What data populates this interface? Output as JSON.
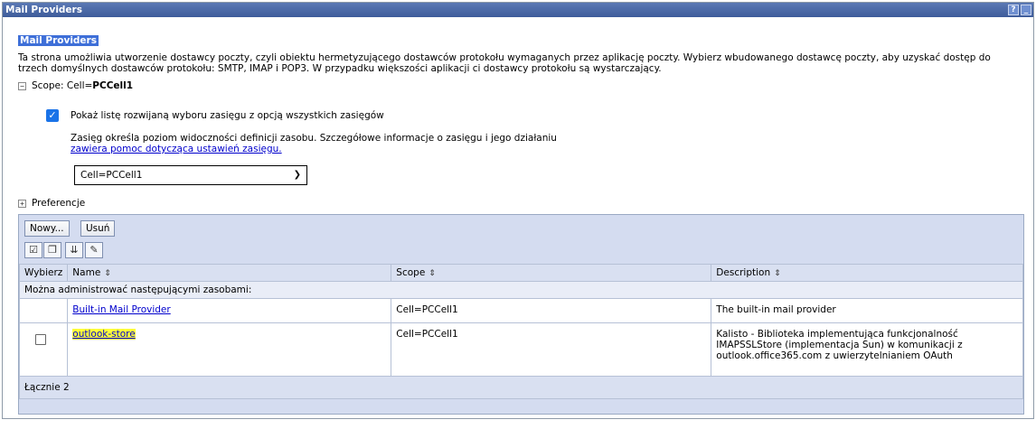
{
  "window": {
    "title": "Mail Providers",
    "help_label": "?",
    "min_label": "_"
  },
  "page": {
    "title": "Mail Providers",
    "description": "Ta strona umożliwia utworzenie dostawcy poczty, czyli obiektu hermetyzującego dostawców protokołu wymaganych przez aplikację poczty. Wybierz wbudowanego dostawcę poczty, aby uzyskać dostęp do trzech domyślnych dostawców protokołu: SMTP, IMAP i POP3. W przypadku większości aplikacji ci dostawcy protokołu są wystarczający."
  },
  "scope": {
    "toggle": "−",
    "label_prefix": "Scope: Cell=",
    "label_value": "PCCell1",
    "checkbox_label": "Pokaż listę rozwijaną wyboru zasięgu z opcją wszystkich zasięgów",
    "checkbox_checked": true,
    "info_text": "Zasięg określa poziom widoczności definicji zasobu. Szczegółowe informacje o zasięgu i jego działaniu ",
    "info_link": "zawiera pomoc dotycząca ustawień zasięgu.",
    "select_value": "Cell=PCCell1"
  },
  "preferences": {
    "toggle": "+",
    "label": "Preferencje"
  },
  "toolbar": {
    "new_label": "Nowy...",
    "delete_label": "Usuń"
  },
  "table": {
    "headers": {
      "select": "Wybierz",
      "name": "Name",
      "scope": "Scope",
      "description": "Description"
    },
    "sort_icon": "⇕",
    "subheader": "Można administrować następującymi zasobami:",
    "rows": [
      {
        "name": "Built-in Mail Provider",
        "scope": "Cell=PCCell1",
        "description": "The built-in mail provider"
      },
      {
        "name": "outlook-store",
        "scope": "Cell=PCCell1",
        "description": "Kalisto - Biblioteka implementująca funkcjonalność IMAPSSLStore (implementacja Sun) w komunikacji z outlook.office365.com z uwierzytelnianiem OAuth"
      }
    ],
    "total": "Łącznie 2"
  },
  "colors": {
    "title_bar": "#3e5c9b",
    "panel": "#d4dcf0",
    "highlight": "#ffff3a",
    "link": "#0000cc"
  }
}
